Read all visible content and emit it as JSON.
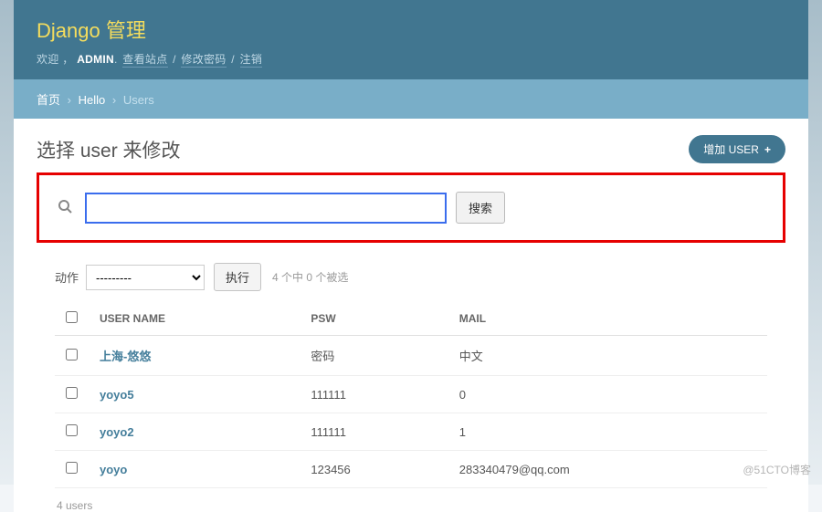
{
  "header": {
    "branding": "Django 管理",
    "welcome": "欢迎 ，",
    "username": "ADMIN",
    "dot": ".",
    "view_site": "查看站点",
    "change_password": "修改密码",
    "logout": "注销"
  },
  "breadcrumbs": {
    "home": "首页",
    "app": "Hello",
    "model": "Users",
    "sep": "›"
  },
  "content": {
    "title": "选择 user 来修改",
    "add_button": "增加 USER"
  },
  "search": {
    "button": "搜索",
    "value": ""
  },
  "actions": {
    "label": "动作",
    "placeholder": "---------",
    "go": "执行",
    "counter": "4 个中 0 个被选"
  },
  "table": {
    "headers": {
      "username": "USER NAME",
      "psw": "PSW",
      "mail": "MAIL"
    },
    "rows": [
      {
        "username": "上海-悠悠",
        "psw": "密码",
        "mail": "中文"
      },
      {
        "username": "yoyo5",
        "psw": "111111",
        "mail": "0"
      },
      {
        "username": "yoyo2",
        "psw": "111111",
        "mail": "1"
      },
      {
        "username": "yoyo",
        "psw": "123456",
        "mail": "283340479@qq.com"
      }
    ]
  },
  "paginator": "4 users",
  "watermark": "@51CTO博客"
}
